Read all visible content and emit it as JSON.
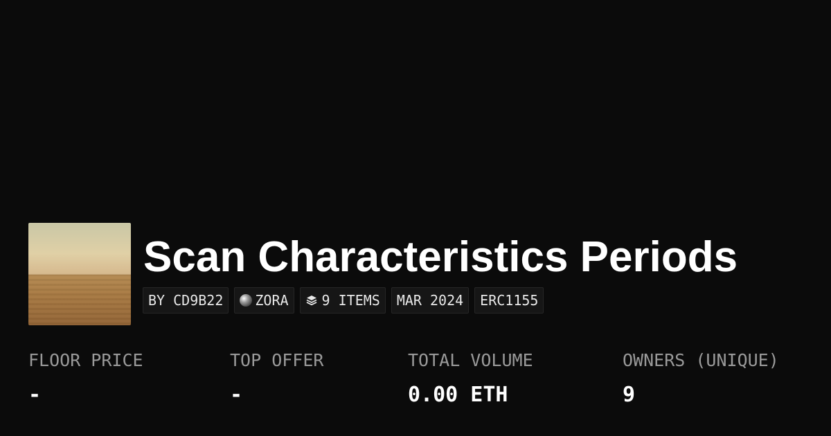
{
  "collection": {
    "title": "Scan Characteristics Periods",
    "thumbnail_icon": "desert-horizon-image"
  },
  "tags": {
    "creator": "BY CD9B22",
    "chain": "ZORA",
    "chain_icon": "zora-orb-icon",
    "items": "9 ITEMS",
    "items_icon": "layers-icon",
    "date": "MAR 2024",
    "standard": "ERC1155"
  },
  "stats": {
    "floor_price": {
      "label": "FLOOR PRICE",
      "value": "-"
    },
    "top_offer": {
      "label": "TOP OFFER",
      "value": "-"
    },
    "total_volume": {
      "label": "TOTAL VOLUME",
      "value": "0.00 ETH"
    },
    "owners": {
      "label": "OWNERS (UNIQUE)",
      "value": "9"
    }
  },
  "colors": {
    "background": "#0b0b0b",
    "label": "#9a9a9a",
    "text": "#ffffff",
    "tag_bg": "#161616"
  }
}
